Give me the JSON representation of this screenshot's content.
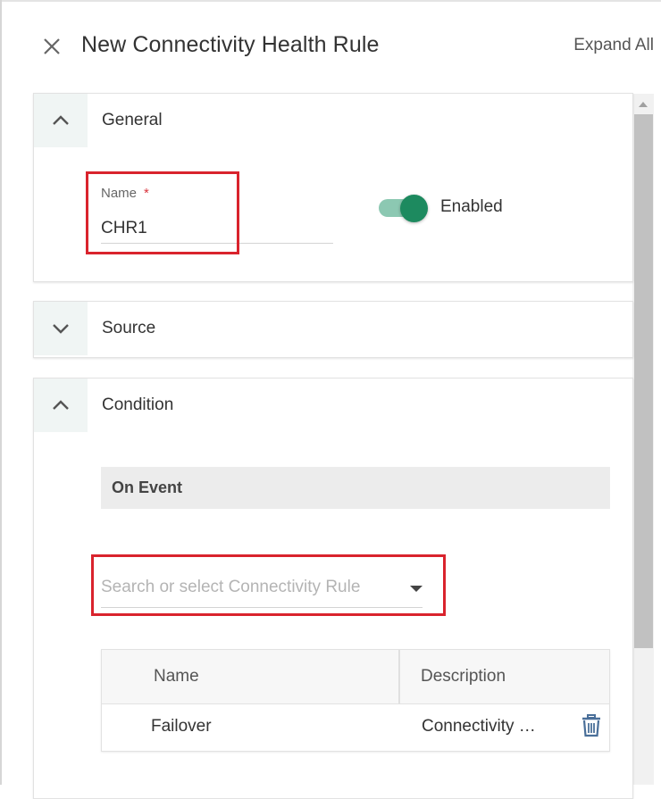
{
  "header": {
    "title": "New Connectivity Health Rule",
    "expand_all_label": "Expand All"
  },
  "sections": {
    "general": {
      "title": "General",
      "expanded": true,
      "name_label": "Name",
      "required_mark": "*",
      "name_value": "CHR1",
      "enabled_label": "Enabled",
      "enabled": true
    },
    "source": {
      "title": "Source",
      "expanded": false
    },
    "condition": {
      "title": "Condition",
      "expanded": true,
      "on_event_label": "On Event",
      "rule_select_placeholder": "Search or select Connectivity Rule",
      "table": {
        "columns": [
          "Name",
          "Description"
        ],
        "rows": [
          {
            "name": "Failover",
            "description": "Connectivity Rule"
          }
        ]
      }
    }
  },
  "colors": {
    "accent": "#1d8a5f",
    "toggle_track": "#8cc8b2",
    "highlight": "#d9232d",
    "required": "#d9363e"
  },
  "icons": {
    "close": "close-icon",
    "collapse": "chevron-up-icon",
    "expand": "chevron-down-icon",
    "dropdown": "caret-down-icon",
    "delete": "trash-icon"
  }
}
